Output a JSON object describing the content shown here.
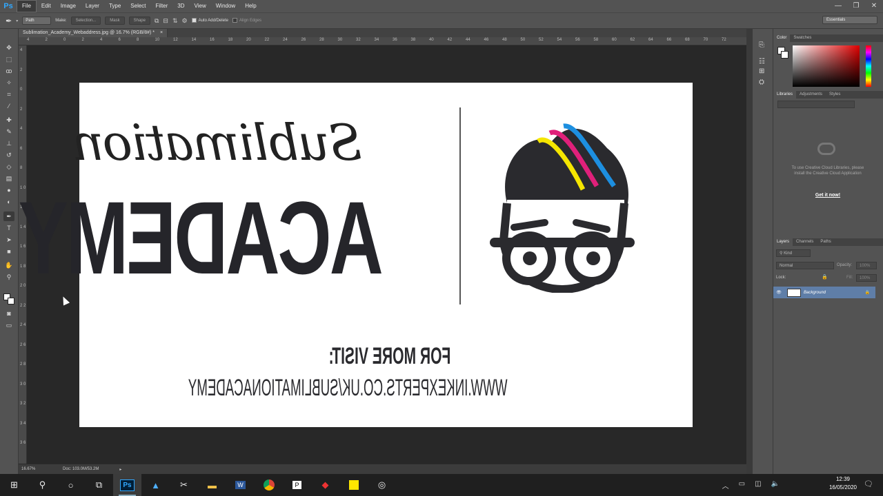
{
  "app": {
    "name": "Ps",
    "window_controls": [
      "—",
      "❐",
      "✕"
    ]
  },
  "menu": [
    "File",
    "Edit",
    "Image",
    "Layer",
    "Type",
    "Select",
    "Filter",
    "3D",
    "View",
    "Window",
    "Help"
  ],
  "options_bar": {
    "mode_value": "Path",
    "make_label": "Make:",
    "selection_btn": "Selection...",
    "mask_btn": "Mask",
    "shape_btn": "Shape",
    "auto_add_delete": "Auto Add/Delete",
    "align_edges": "Align Edges",
    "workspace": "Essentials"
  },
  "document": {
    "tab_title": "Sublimation_Academy_Webaddress.jpg @ 16.7% (RGB/8#) *",
    "zoom": "16.67%",
    "doc_size": "Doc: 103.0M/53.2M"
  },
  "ruler": {
    "top": [
      "4",
      "2",
      "0",
      "2",
      "4",
      "6",
      "8",
      "10",
      "12",
      "14",
      "16",
      "18",
      "20",
      "22",
      "24",
      "26",
      "28",
      "30",
      "32",
      "34",
      "36",
      "38",
      "40",
      "42",
      "44",
      "46",
      "48",
      "50",
      "52",
      "54",
      "56",
      "58",
      "60",
      "62",
      "64",
      "66",
      "68",
      "70",
      "72"
    ],
    "left": [
      "4",
      "2",
      "0",
      "2",
      "4",
      "6",
      "8",
      "1 0",
      "1 2",
      "1 4",
      "1 6",
      "1 8",
      "2 0",
      "2 2",
      "2 4",
      "2 6",
      "2 8",
      "3 0",
      "3 2",
      "3 4",
      "3 6"
    ]
  },
  "artwork": {
    "script_word": "Sublimation",
    "academy_word": "ACADEMY",
    "for_more": "FOR MORE VISIT:",
    "url": "WWW.INKEXPERTS.CO.UK/SUBLIMATIONACADEMY",
    "feather_colors": [
      "#f5e600",
      "#e0207a",
      "#1d8fe0"
    ],
    "ink_color": "#2a2a2e"
  },
  "panels": {
    "color_tabs": [
      "Color",
      "Swatches"
    ],
    "library_tabs": [
      "Libraries",
      "Adjustments",
      "Styles"
    ],
    "library_message": "To use Creative Cloud Libraries, please install the Creative Cloud Application",
    "library_link": "Get it now!",
    "layer_tabs": [
      "Layers",
      "Channels",
      "Paths"
    ],
    "kind_filter": "Kind",
    "blend_mode": "Normal",
    "opacity_label": "Opacity:",
    "opacity_value": "100%",
    "lock_label": "Lock:",
    "fill_label": "Fill:",
    "fill_value": "100%",
    "layer_name": "Background"
  },
  "taskbar": {
    "time": "12:39",
    "date": "16/05/2020"
  }
}
